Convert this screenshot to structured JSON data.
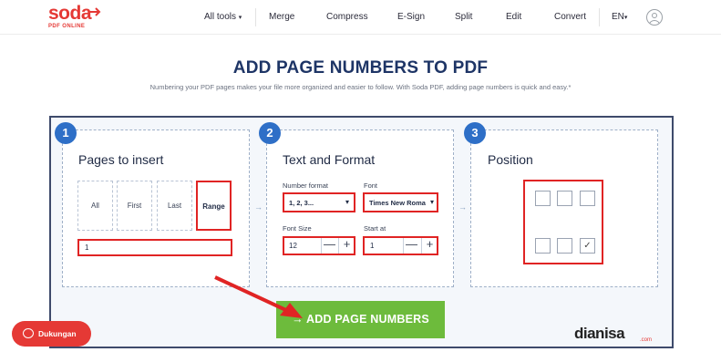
{
  "header": {
    "logo_main": "soda",
    "logo_sub": "PDF ONLINE",
    "nav": [
      "All tools",
      "Merge",
      "Compress",
      "E-Sign",
      "Split",
      "Edit",
      "Convert"
    ],
    "language": "EN"
  },
  "page": {
    "title": "ADD PAGE NUMBERS TO PDF",
    "subtitle": "Numbering your PDF pages makes your file more organized and easier to follow. With Soda PDF, adding page numbers is quick and easy.*"
  },
  "steps": {
    "step1": {
      "number": "1",
      "title": "Pages to insert",
      "options": [
        "All",
        "First",
        "Last",
        "Range"
      ],
      "selected": "Range",
      "range_value": "1"
    },
    "step2": {
      "number": "2",
      "title": "Text and Format",
      "number_format_label": "Number format",
      "number_format_value": "1, 2, 3...",
      "font_label": "Font",
      "font_value": "Times New Roma",
      "font_size_label": "Font Size",
      "font_size_value": "12",
      "start_at_label": "Start at",
      "start_at_value": "1"
    },
    "step3": {
      "number": "3",
      "title": "Position",
      "selected_position": "bottom-right"
    }
  },
  "action": {
    "add_label": "→ ADD PAGE NUMBERS"
  },
  "support": {
    "label": "Dukungan"
  },
  "watermark": {
    "text": "dianisa",
    "suffix": ".com"
  },
  "colors": {
    "brand_red": "#e53935",
    "step_blue": "#2e6fc7",
    "button_green": "#6dbb3c",
    "highlight_red": "#e02424",
    "title_navy": "#1e3566"
  }
}
